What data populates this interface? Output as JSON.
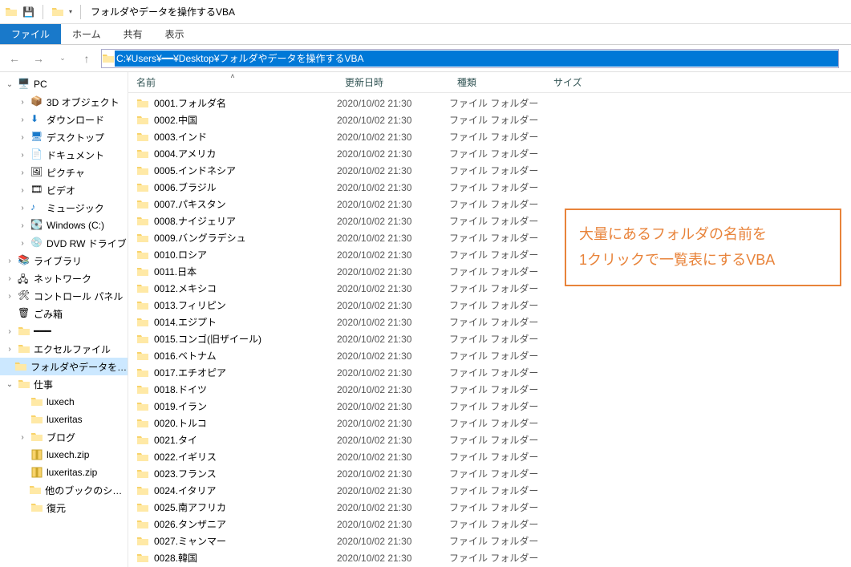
{
  "title": "フォルダやデータを操作するVBA",
  "ribbon": {
    "file": "ファイル",
    "home": "ホーム",
    "share": "共有",
    "view": "表示"
  },
  "address_path": "C:¥Users¥━━¥Desktop¥フォルダやデータを操作するVBA",
  "columns": {
    "name": "名前",
    "date": "更新日時",
    "type": "種類",
    "size": "サイズ"
  },
  "tree": {
    "pc": "PC",
    "objects3d": "3D オブジェクト",
    "downloads": "ダウンロード",
    "desktop": "デスクトップ",
    "documents": "ドキュメント",
    "pictures": "ピクチャ",
    "videos": "ビデオ",
    "music": "ミュージック",
    "cdrive": "Windows (C:)",
    "dvd": "DVD RW ドライブ",
    "libraries": "ライブラリ",
    "network": "ネットワーク",
    "controlpanel": "コントロール パネル",
    "recycle": "ごみ箱",
    "user": "━━━",
    "excelfiles": "エクセルファイル",
    "currentfolder": "フォルダやデータを操作するVBA",
    "work": "仕事",
    "luxech": "luxech",
    "luxeritas": "luxeritas",
    "blog": "ブログ",
    "luxechzip": "luxech.zip",
    "luxeritaszip": "luxeritas.zip",
    "otherbooks": "他のブックのシート…",
    "restore": "復元"
  },
  "callout": {
    "line1": "大量にあるフォルダの名前を",
    "line2": "1クリックで一覧表にするVBA"
  },
  "shared_date": "2020/10/02 21:30",
  "shared_type": "ファイル フォルダー",
  "rows": [
    {
      "name": "0001.フォルダ名"
    },
    {
      "name": "0002.中国"
    },
    {
      "name": "0003.インド"
    },
    {
      "name": "0004.アメリカ"
    },
    {
      "name": "0005.インドネシア"
    },
    {
      "name": "0006.ブラジル"
    },
    {
      "name": "0007.パキスタン"
    },
    {
      "name": "0008.ナイジェリア"
    },
    {
      "name": "0009.バングラデシュ"
    },
    {
      "name": "0010.ロシア"
    },
    {
      "name": "0011.日本"
    },
    {
      "name": "0012.メキシコ"
    },
    {
      "name": "0013.フィリピン"
    },
    {
      "name": "0014.エジプト"
    },
    {
      "name": "0015.コンゴ(旧ザイール)"
    },
    {
      "name": "0016.ベトナム"
    },
    {
      "name": "0017.エチオピア"
    },
    {
      "name": "0018.ドイツ"
    },
    {
      "name": "0019.イラン"
    },
    {
      "name": "0020.トルコ"
    },
    {
      "name": "0021.タイ"
    },
    {
      "name": "0022.イギリス"
    },
    {
      "name": "0023.フランス"
    },
    {
      "name": "0024.イタリア"
    },
    {
      "name": "0025.南アフリカ"
    },
    {
      "name": "0026.タンザニア"
    },
    {
      "name": "0027.ミャンマー"
    },
    {
      "name": "0028.韓国"
    }
  ]
}
